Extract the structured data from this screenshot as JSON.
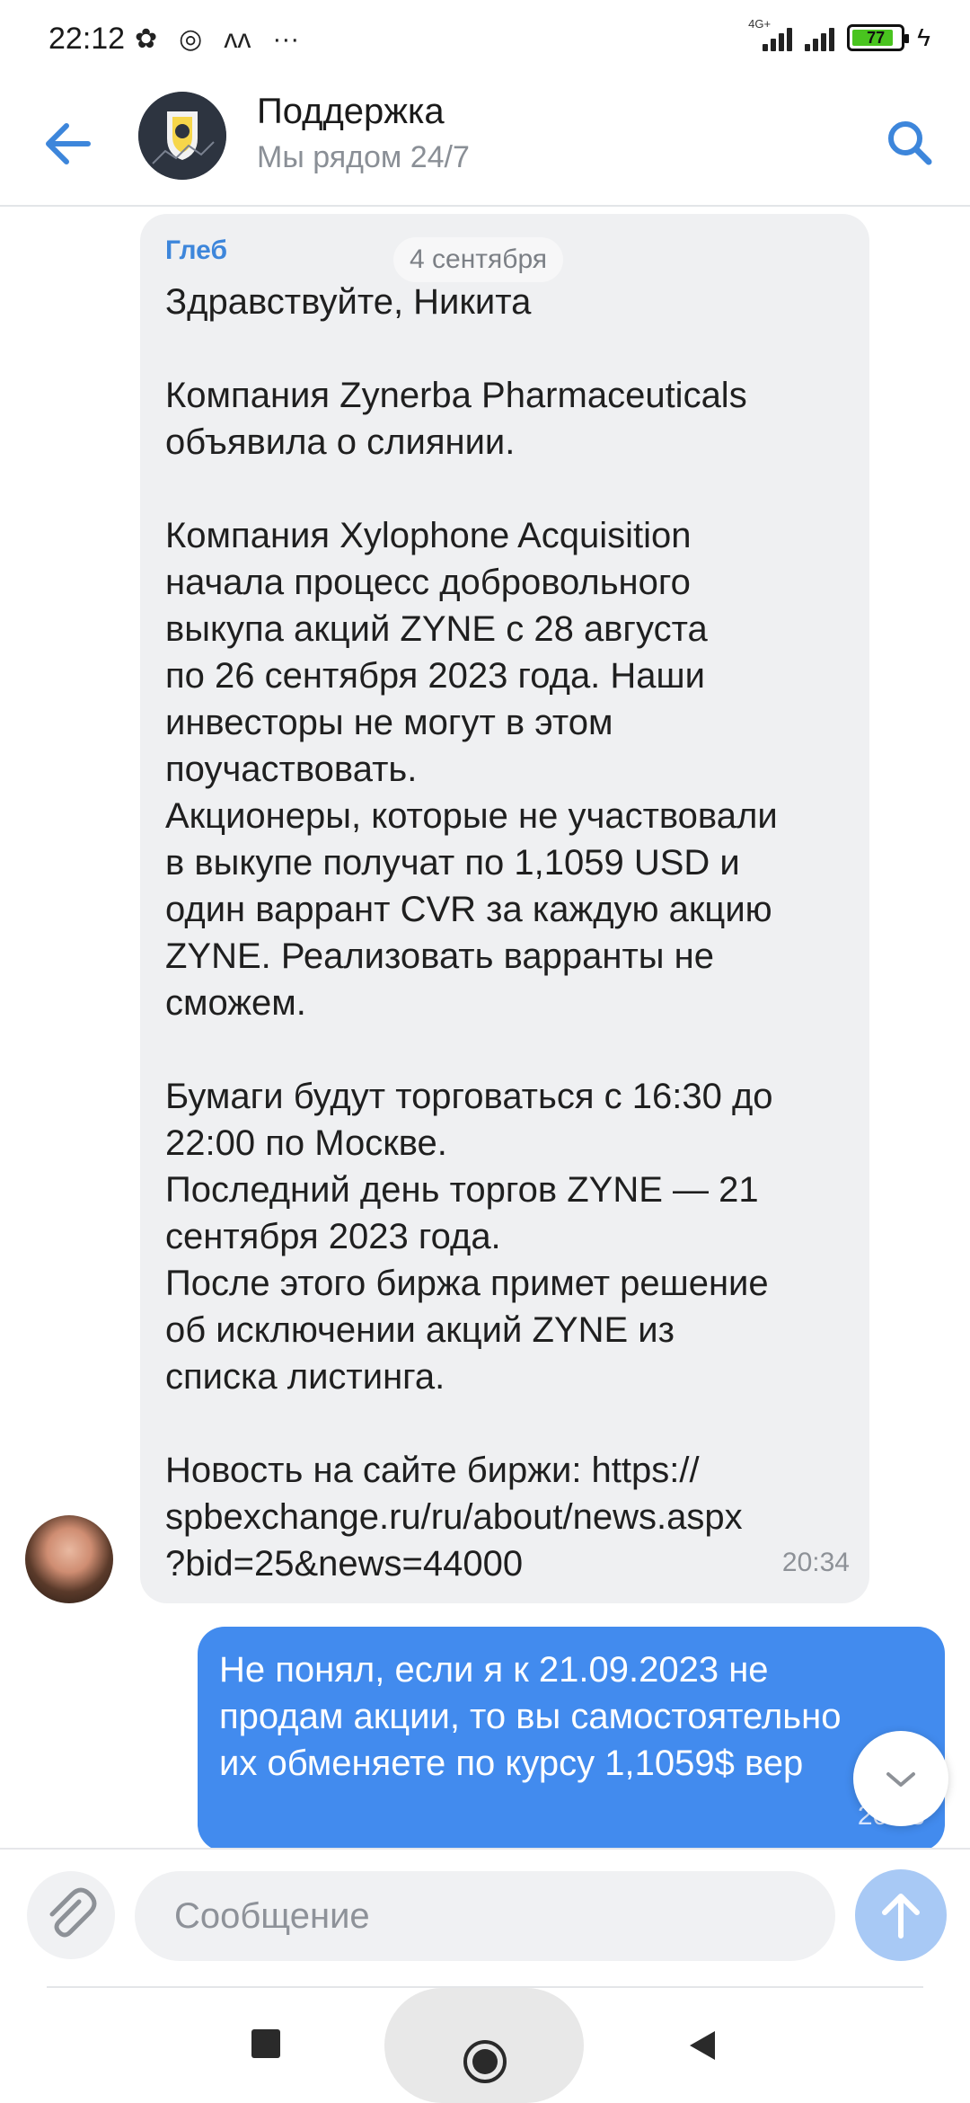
{
  "status_bar": {
    "time": "22:12",
    "network_label": "4G+",
    "battery": "77",
    "battery_level": 0.77
  },
  "header": {
    "title": "Поддержка",
    "subtitle": "Мы рядом 24/7"
  },
  "date_chip": "4 сентября",
  "messages": {
    "incoming": {
      "sender": "Глеб",
      "text": "Здравствуйте, Никита\n\nКомпания Zynerba Pharmaceuticals\nобъявила о слиянии.\n\nКомпания Xylophone Acquisition\nначала процесс добровольного\nвыкупа акций ZYNE с 28 августа\nпо 26 сентября 2023 года. Наши\nинвесторы не могут в этом\nпоучаствовать.\nАкционеры, которые не участвовали\nв выкупе получат по 1,1059 USD и\nодин варрант CVR за каждую акцию\nZYNE. Реализовать варранты не\nсможем.\n\nБумаги будут торговаться с 16:30 до\n22:00 по Москве.\nПоследний день торгов ZYNE — 21\nсентября 2023 года.\nПосле этого биржа примет решение\nоб исключении акций ZYNE из\nсписка листинга.\n\nНовость на сайте биржи: https://\nspbexchange.ru/ru/about/news.aspx\n?bid=25&news=44000",
      "time": "20:34"
    },
    "outgoing": {
      "text": "Не понял, если я к 21.09.2023 не\nпродам акции, то вы самостоятельно\nих обменяете по курсу 1,1059$ вер",
      "time": "20:58"
    }
  },
  "composer": {
    "placeholder": "Сообщение"
  },
  "colors": {
    "accent": "#3d86db",
    "outgoing_bubble": "#428bee",
    "incoming_bubble": "#eff0f2",
    "send_button": "#a8c9f5",
    "battery_fill": "#49c41f"
  },
  "icons": {
    "back": "arrow-left-icon",
    "search": "search-icon",
    "attach": "paperclip-icon",
    "send": "arrow-up-icon",
    "scroll_down": "chevron-down-icon"
  }
}
